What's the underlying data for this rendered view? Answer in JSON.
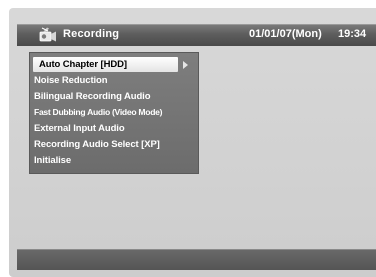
{
  "header": {
    "icon": "recording-camera-icon",
    "title": "Recording",
    "date": "01/01/07(Mon)",
    "time": "19:34"
  },
  "menu": {
    "items": [
      {
        "label": "Auto Chapter [HDD]",
        "selected": true
      },
      {
        "label": "Noise Reduction",
        "selected": false
      },
      {
        "label": "Bilingual Recording Audio",
        "selected": false
      },
      {
        "label": "Fast Dubbing Audio (Video Mode)",
        "selected": false
      },
      {
        "label": "External Input Audio",
        "selected": false
      },
      {
        "label": "Recording Audio Select [XP]",
        "selected": false
      },
      {
        "label": "Initialise",
        "selected": false
      }
    ],
    "submenu_indicator_icon": "chevron-right-icon"
  },
  "colors": {
    "background": "#d4d4d4",
    "header_bar": "#5e5e5e",
    "menu_panel": "#747474",
    "selected_item": "#f2f2f2",
    "text": "#ffffff"
  }
}
